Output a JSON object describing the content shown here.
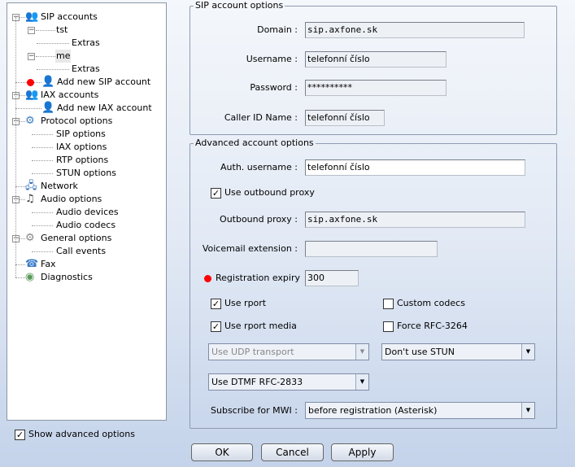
{
  "tree": [
    {
      "label": "SIP accounts",
      "level": 0,
      "icon": "users-icon"
    },
    {
      "label": "tst",
      "level": 1
    },
    {
      "label": "Extras",
      "level": 2
    },
    {
      "label": "me",
      "level": 1,
      "selected": true
    },
    {
      "label": "Extras",
      "level": 2
    },
    {
      "label": "Add new SIP account",
      "level": 1,
      "icon": "add-user-icon",
      "marker": true
    },
    {
      "label": "IAX accounts",
      "level": 0,
      "icon": "iax-users-icon"
    },
    {
      "label": "Add new IAX account",
      "level": 1,
      "icon": "add-iax-user-icon"
    },
    {
      "label": "Protocol options",
      "level": 0,
      "icon": "protocol-icon"
    },
    {
      "label": "SIP options",
      "level": 1
    },
    {
      "label": "IAX options",
      "level": 1
    },
    {
      "label": "RTP options",
      "level": 1
    },
    {
      "label": "STUN options",
      "level": 1
    },
    {
      "label": "Network",
      "level": 0,
      "icon": "network-icon"
    },
    {
      "label": "Audio options",
      "level": 0,
      "icon": "music-note-icon"
    },
    {
      "label": "Audio devices",
      "level": 1
    },
    {
      "label": "Audio codecs",
      "level": 1
    },
    {
      "label": "General options",
      "level": 0,
      "icon": "gear-icon"
    },
    {
      "label": "Call events",
      "level": 1
    },
    {
      "label": "Fax",
      "level": 0,
      "icon": "fax-icon"
    },
    {
      "label": "Diagnostics",
      "level": 0,
      "icon": "diagnostics-icon"
    }
  ],
  "show_advanced": {
    "label": "Show advanced options",
    "checked": true
  },
  "sip": {
    "legend": "SIP account options",
    "domain_label": "Domain :",
    "domain": "sip.axfone.sk",
    "username_label": "Username :",
    "username": "telefonní číslo",
    "password_label": "Password :",
    "password": "**********",
    "callerid_label": "Caller ID Name :",
    "callerid": "telefonní číslo"
  },
  "adv": {
    "legend": "Advanced account options",
    "auth_label": "Auth. username :",
    "auth": "telefonní číslo",
    "use_proxy": "Use outbound proxy",
    "proxy_label": "Outbound proxy :",
    "proxy": "sip.axfone.sk",
    "vm_label": "Voicemail extension :",
    "vm": "",
    "reg_label": "Registration expiry  :",
    "reg": "300",
    "use_rport": "Use rport",
    "custom_codecs": "Custom codecs",
    "use_rport_media": "Use rport media",
    "force_rfc": "Force RFC-3264",
    "transport": "Use UDP transport",
    "stun": "Don't use STUN",
    "dtmf": "Use DTMF RFC-2833",
    "mwi_label": "Subscribe for MWI :",
    "mwi": "before registration (Asterisk)"
  },
  "buttons": {
    "ok": "OK",
    "cancel": "Cancel",
    "apply": "Apply"
  },
  "colors": {
    "marker": "#ff0000",
    "border": "#8c9bb3"
  }
}
